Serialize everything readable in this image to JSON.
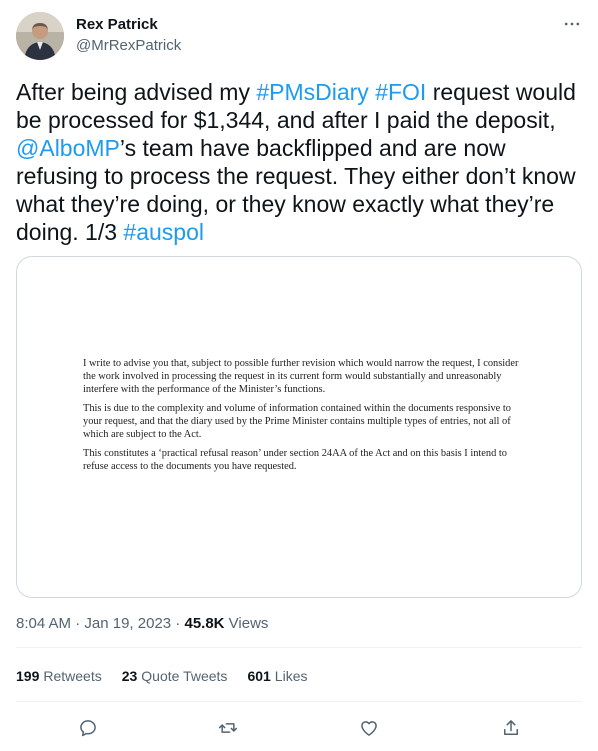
{
  "author": {
    "name": "Rex Patrick",
    "handle": "@MrRexPatrick",
    "avatar_icon": "avatar-photo"
  },
  "more_icon": "more-horizontal-icon",
  "tweet": {
    "segments": [
      {
        "text": "After being advised my ",
        "link": false
      },
      {
        "text": "#PMsDiary",
        "link": true
      },
      {
        "text": " ",
        "link": false
      },
      {
        "text": "#FOI",
        "link": true
      },
      {
        "text": " request would be processed for $1,344, and after I paid the deposit, ",
        "link": false
      },
      {
        "text": "@AlboMP",
        "link": true
      },
      {
        "text": "’s team have backflipped and are now refusing to process the request. They either don’t know what they’re doing, or they know exactly what they’re doing. 1/3 ",
        "link": false
      },
      {
        "text": "#auspol",
        "link": true
      }
    ]
  },
  "media": {
    "paragraphs": [
      "I write to advise you that, subject to possible further revision which would narrow the request, I consider the work involved in processing the request in its current form would substantially and unreasonably interfere with the performance of the Minister’s functions.",
      "This is due to the complexity and volume of information contained within the documents responsive to your request, and that the diary used by the Prime Minister contains multiple types of entries, not all of which are subject to the Act.",
      "This constitutes a ‘practical refusal reason’ under section 24AA of the Act and on this basis I intend to refuse access to the documents you have requested."
    ]
  },
  "meta": {
    "time": "8:04 AM",
    "separator": " · ",
    "date": "Jan 19, 2023",
    "views_count": "45.8K",
    "views_label": " Views"
  },
  "stats": {
    "retweets_count": "199",
    "retweets_label": "Retweets",
    "quotes_count": "23",
    "quotes_label": "Quote Tweets",
    "likes_count": "601",
    "likes_label": "Likes"
  },
  "actions": [
    "reply-icon",
    "retweet-icon",
    "like-icon",
    "share-icon"
  ],
  "colors": {
    "link": "#1d9bf0",
    "secondary_text": "#536471",
    "primary_text": "#0f1419",
    "border": "#cfd9de"
  }
}
